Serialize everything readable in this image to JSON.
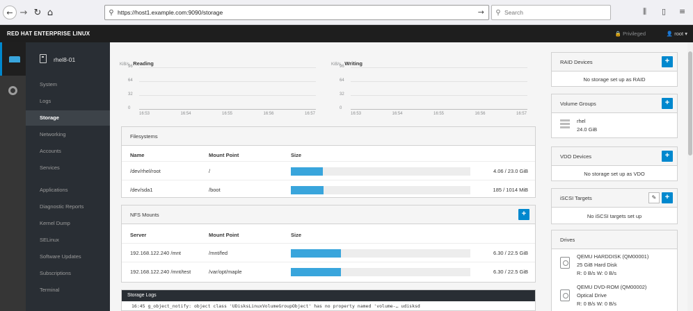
{
  "browser": {
    "url": "https://host1.example.com:9090/storage",
    "search_placeholder": "Search",
    "back_glyph": "←",
    "forward_glyph": "→",
    "reload_glyph": "↻",
    "home_glyph": "⌂",
    "go_glyph": "→",
    "search_glyph": "⚲",
    "library_glyph": "⫼",
    "sidebar_glyph": "▯",
    "menu_glyph": "≡"
  },
  "header": {
    "brand": "RED HAT ENTERPRISE LINUX",
    "privileged": "🔒 Privileged",
    "user": "👤 root ▾"
  },
  "host": {
    "name": "rhel8-01"
  },
  "sidebar": {
    "items": [
      {
        "label": "System",
        "active": false
      },
      {
        "label": "Logs",
        "active": false
      },
      {
        "label": "Storage",
        "active": true
      },
      {
        "label": "Networking",
        "active": false
      },
      {
        "label": "Accounts",
        "active": false
      },
      {
        "label": "Services",
        "active": false
      },
      {
        "label": "Applications",
        "active": false
      },
      {
        "label": "Diagnostic Reports",
        "active": false
      },
      {
        "label": "Kernel Dump",
        "active": false
      },
      {
        "label": "SELinux",
        "active": false
      },
      {
        "label": "Software Updates",
        "active": false
      },
      {
        "label": "Subscriptions",
        "active": false
      },
      {
        "label": "Terminal",
        "active": false
      }
    ]
  },
  "charts": {
    "reading": {
      "unit": "KiB/s",
      "title": "Reading"
    },
    "writing": {
      "unit": "KiB/s",
      "title": "Writing"
    }
  },
  "chart_data": [
    {
      "type": "line",
      "title": "Reading",
      "ylabel": "KiB/s",
      "y_ticks": [
        0,
        32,
        64,
        96
      ],
      "ylim": [
        0,
        96
      ],
      "x_ticks": [
        "16:53",
        "16:54",
        "16:55",
        "16:56",
        "16:57"
      ],
      "series": []
    },
    {
      "type": "line",
      "title": "Writing",
      "ylabel": "KiB/s",
      "y_ticks": [
        0,
        32,
        64,
        96
      ],
      "ylim": [
        0,
        96
      ],
      "x_ticks": [
        "16:53",
        "16:54",
        "16:55",
        "16:56",
        "16:57"
      ],
      "series": []
    }
  ],
  "filesystems": {
    "title": "Filesystems",
    "columns": [
      "Name",
      "Mount Point",
      "Size"
    ],
    "rows": [
      {
        "name": "/dev/rhel/root",
        "mount": "/",
        "size": "4.06 / 23.0 GiB",
        "usage": 0.177
      },
      {
        "name": "/dev/sda1",
        "mount": "/boot",
        "size": "185 / 1014 MiB",
        "usage": 0.182
      }
    ]
  },
  "nfs": {
    "title": "NFS Mounts",
    "add_label": "+",
    "columns": [
      "Server",
      "Mount Point",
      "Size"
    ],
    "rows": [
      {
        "server": "192.168.122.240 /mnt",
        "mount": "/mnt/fed",
        "size": "6.30 / 22.5 GiB",
        "usage": 0.28
      },
      {
        "server": "192.168.122.240 /mnt/test",
        "mount": "/var/opt/maple",
        "size": "6.30 / 22.5 GiB",
        "usage": 0.28
      }
    ]
  },
  "logs": {
    "title": "Storage Logs",
    "line": "16:45 g_object_notify: object class 'UDisksLinuxVolumeGroupObject' has no property named 'volume-… udisksd"
  },
  "raid": {
    "title": "RAID Devices",
    "empty": "No storage set up as RAID",
    "add_label": "+"
  },
  "volume_groups": {
    "title": "Volume Groups",
    "add_label": "+",
    "name": "rhel",
    "size": "24.0 GiB"
  },
  "vdo": {
    "title": "VDO Devices",
    "empty": "No storage set up as VDO",
    "add_label": "+"
  },
  "iscsi": {
    "title": "iSCSI Targets",
    "empty": "No iSCSI targets set up",
    "add_label": "+",
    "edit_label": "✎"
  },
  "drives": {
    "title": "Drives",
    "items": [
      {
        "name": "QEMU HARDDISK (QM00001)",
        "type": "25 GiB Hard Disk",
        "rate": "R: 0 B/s    W: 0 B/s"
      },
      {
        "name": "QEMU DVD-ROM (QM00002)",
        "type": "Optical Drive",
        "rate": "R: 0 B/s    W: 0 B/s"
      }
    ]
  },
  "colors": {
    "accent": "#0088ce",
    "bar": "#39a5dc",
    "nav_bg": "#292e34",
    "topbar": "#1e1e1e"
  }
}
